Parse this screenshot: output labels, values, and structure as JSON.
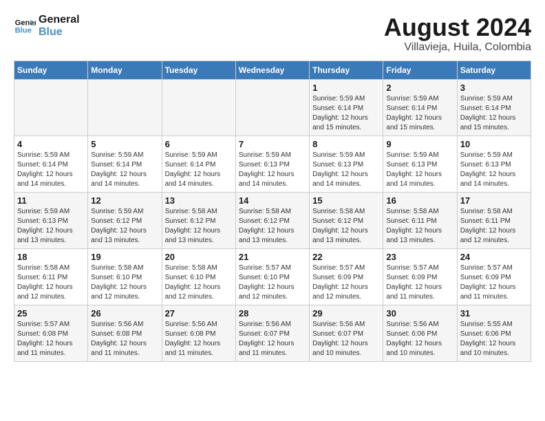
{
  "header": {
    "logo_line1": "General",
    "logo_line2": "Blue",
    "month_year": "August 2024",
    "location": "Villavieja, Huila, Colombia"
  },
  "days_of_week": [
    "Sunday",
    "Monday",
    "Tuesday",
    "Wednesday",
    "Thursday",
    "Friday",
    "Saturday"
  ],
  "weeks": [
    [
      {
        "day": "",
        "info": ""
      },
      {
        "day": "",
        "info": ""
      },
      {
        "day": "",
        "info": ""
      },
      {
        "day": "",
        "info": ""
      },
      {
        "day": "1",
        "info": "Sunrise: 5:59 AM\nSunset: 6:14 PM\nDaylight: 12 hours\nand 15 minutes."
      },
      {
        "day": "2",
        "info": "Sunrise: 5:59 AM\nSunset: 6:14 PM\nDaylight: 12 hours\nand 15 minutes."
      },
      {
        "day": "3",
        "info": "Sunrise: 5:59 AM\nSunset: 6:14 PM\nDaylight: 12 hours\nand 15 minutes."
      }
    ],
    [
      {
        "day": "4",
        "info": "Sunrise: 5:59 AM\nSunset: 6:14 PM\nDaylight: 12 hours\nand 14 minutes."
      },
      {
        "day": "5",
        "info": "Sunrise: 5:59 AM\nSunset: 6:14 PM\nDaylight: 12 hours\nand 14 minutes."
      },
      {
        "day": "6",
        "info": "Sunrise: 5:59 AM\nSunset: 6:14 PM\nDaylight: 12 hours\nand 14 minutes."
      },
      {
        "day": "7",
        "info": "Sunrise: 5:59 AM\nSunset: 6:13 PM\nDaylight: 12 hours\nand 14 minutes."
      },
      {
        "day": "8",
        "info": "Sunrise: 5:59 AM\nSunset: 6:13 PM\nDaylight: 12 hours\nand 14 minutes."
      },
      {
        "day": "9",
        "info": "Sunrise: 5:59 AM\nSunset: 6:13 PM\nDaylight: 12 hours\nand 14 minutes."
      },
      {
        "day": "10",
        "info": "Sunrise: 5:59 AM\nSunset: 6:13 PM\nDaylight: 12 hours\nand 14 minutes."
      }
    ],
    [
      {
        "day": "11",
        "info": "Sunrise: 5:59 AM\nSunset: 6:13 PM\nDaylight: 12 hours\nand 13 minutes."
      },
      {
        "day": "12",
        "info": "Sunrise: 5:59 AM\nSunset: 6:12 PM\nDaylight: 12 hours\nand 13 minutes."
      },
      {
        "day": "13",
        "info": "Sunrise: 5:58 AM\nSunset: 6:12 PM\nDaylight: 12 hours\nand 13 minutes."
      },
      {
        "day": "14",
        "info": "Sunrise: 5:58 AM\nSunset: 6:12 PM\nDaylight: 12 hours\nand 13 minutes."
      },
      {
        "day": "15",
        "info": "Sunrise: 5:58 AM\nSunset: 6:12 PM\nDaylight: 12 hours\nand 13 minutes."
      },
      {
        "day": "16",
        "info": "Sunrise: 5:58 AM\nSunset: 6:11 PM\nDaylight: 12 hours\nand 13 minutes."
      },
      {
        "day": "17",
        "info": "Sunrise: 5:58 AM\nSunset: 6:11 PM\nDaylight: 12 hours\nand 12 minutes."
      }
    ],
    [
      {
        "day": "18",
        "info": "Sunrise: 5:58 AM\nSunset: 6:11 PM\nDaylight: 12 hours\nand 12 minutes."
      },
      {
        "day": "19",
        "info": "Sunrise: 5:58 AM\nSunset: 6:10 PM\nDaylight: 12 hours\nand 12 minutes."
      },
      {
        "day": "20",
        "info": "Sunrise: 5:58 AM\nSunset: 6:10 PM\nDaylight: 12 hours\nand 12 minutes."
      },
      {
        "day": "21",
        "info": "Sunrise: 5:57 AM\nSunset: 6:10 PM\nDaylight: 12 hours\nand 12 minutes."
      },
      {
        "day": "22",
        "info": "Sunrise: 5:57 AM\nSunset: 6:09 PM\nDaylight: 12 hours\nand 12 minutes."
      },
      {
        "day": "23",
        "info": "Sunrise: 5:57 AM\nSunset: 6:09 PM\nDaylight: 12 hours\nand 11 minutes."
      },
      {
        "day": "24",
        "info": "Sunrise: 5:57 AM\nSunset: 6:09 PM\nDaylight: 12 hours\nand 11 minutes."
      }
    ],
    [
      {
        "day": "25",
        "info": "Sunrise: 5:57 AM\nSunset: 6:08 PM\nDaylight: 12 hours\nand 11 minutes."
      },
      {
        "day": "26",
        "info": "Sunrise: 5:56 AM\nSunset: 6:08 PM\nDaylight: 12 hours\nand 11 minutes."
      },
      {
        "day": "27",
        "info": "Sunrise: 5:56 AM\nSunset: 6:08 PM\nDaylight: 12 hours\nand 11 minutes."
      },
      {
        "day": "28",
        "info": "Sunrise: 5:56 AM\nSunset: 6:07 PM\nDaylight: 12 hours\nand 11 minutes."
      },
      {
        "day": "29",
        "info": "Sunrise: 5:56 AM\nSunset: 6:07 PM\nDaylight: 12 hours\nand 10 minutes."
      },
      {
        "day": "30",
        "info": "Sunrise: 5:56 AM\nSunset: 6:06 PM\nDaylight: 12 hours\nand 10 minutes."
      },
      {
        "day": "31",
        "info": "Sunrise: 5:55 AM\nSunset: 6:06 PM\nDaylight: 12 hours\nand 10 minutes."
      }
    ]
  ]
}
